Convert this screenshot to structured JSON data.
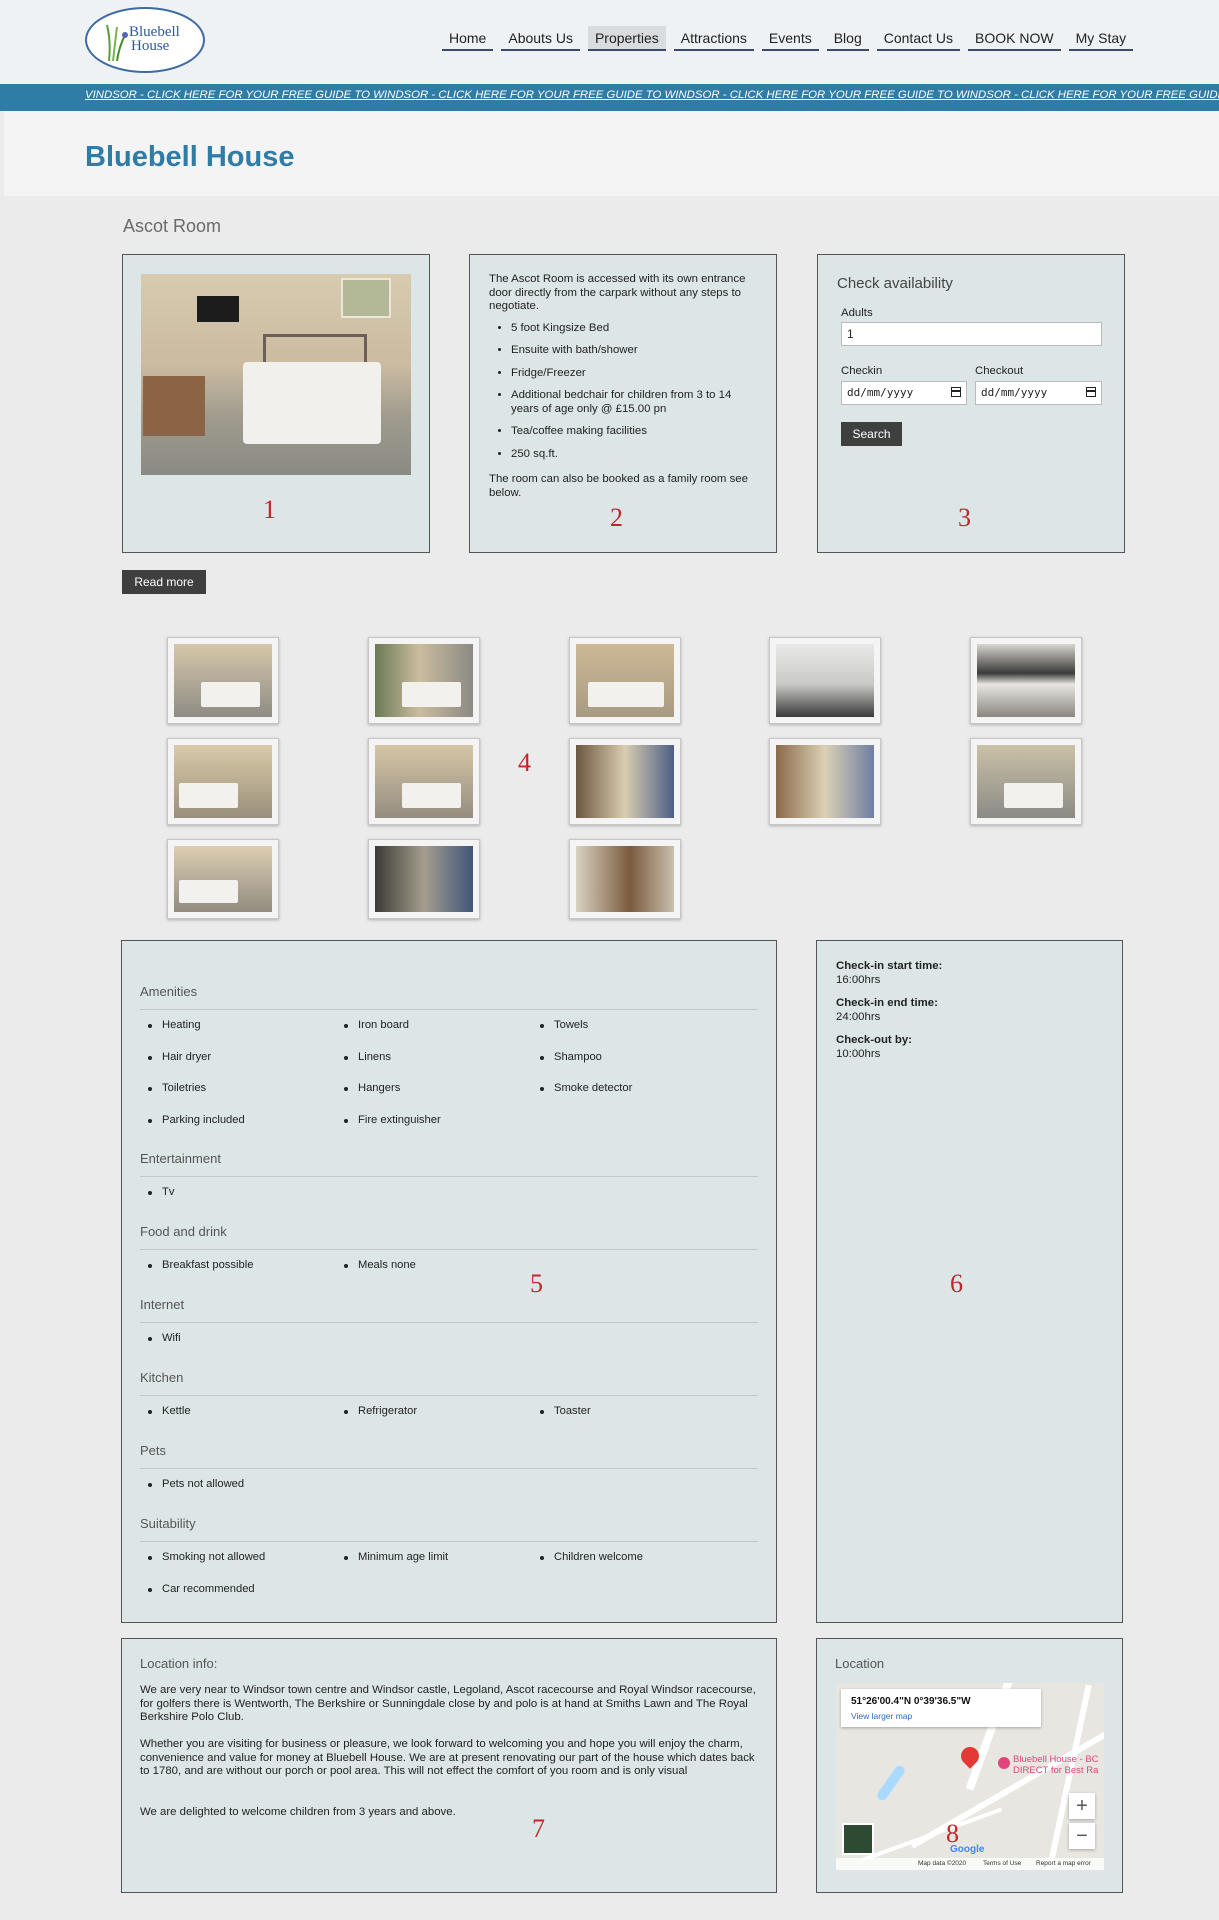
{
  "header": {
    "logo_text_line1": "Bluebell",
    "logo_text_line2": "House",
    "nav": [
      "Home",
      "Abouts Us",
      "Properties",
      "Attractions",
      "Events",
      "Blog",
      "Contact Us",
      "BOOK NOW",
      "My Stay"
    ],
    "active_nav": "Properties"
  },
  "ticker": {
    "text": "VINDSOR - CLICK HERE FOR YOUR FREE GUIDE TO WINDSOR - CLICK HERE FOR YOUR FREE GUIDE TO WINDSOR - CLICK HERE FOR YOUR FREE GUIDE TO WINDSOR - CLICK HERE FOR YOUR FREE GUIDE TO WINDSOR\""
  },
  "page": {
    "site_title": "Bluebell House",
    "room_title": "Ascot Room"
  },
  "photo_box": {
    "number": "1"
  },
  "description": {
    "intro": "The Ascot Room is accessed with its own entrance door directly from the carpark without any steps to negotiate.",
    "features": [
      "5 foot Kingsize Bed",
      "Ensuite with bath/shower",
      "Fridge/Freezer",
      "Additional bedchair for children from 3 to 14 years of age only @ £15.00 pn",
      "Tea/coffee making facilities",
      "250 sq.ft."
    ],
    "outro": "The room can also be booked as a family room see below.",
    "number": "2"
  },
  "availability": {
    "heading": "Check availability",
    "adults_label": "Adults",
    "adults_value": "1",
    "checkin_label": "Checkin",
    "checkout_label": "Checkout",
    "date_placeholder": "dd/mm/yyyy",
    "search_label": "Search",
    "number": "3"
  },
  "read_more_label": "Read more",
  "gallery": {
    "number": "4",
    "thumb_count": 13
  },
  "amenities": {
    "number": "5",
    "sections": [
      {
        "title": "Amenities",
        "items": [
          "Heating",
          "Iron board",
          "Towels",
          "Hair dryer",
          "Linens",
          "Shampoo",
          "Toiletries",
          "Hangers",
          "Smoke detector",
          "Parking included",
          "Fire extinguisher"
        ]
      },
      {
        "title": "Entertainment",
        "items": [
          "Tv"
        ]
      },
      {
        "title": "Food and drink",
        "items": [
          "Breakfast possible",
          "Meals none"
        ]
      },
      {
        "title": "Internet",
        "items": [
          "Wifi"
        ]
      },
      {
        "title": "Kitchen",
        "items": [
          "Kettle",
          "Refrigerator",
          "Toaster"
        ]
      },
      {
        "title": "Pets",
        "items": [
          "Pets not allowed"
        ]
      },
      {
        "title": "Suitability",
        "items": [
          "Smoking not allowed",
          "Minimum age limit",
          "Children welcome",
          "Car recommended"
        ]
      }
    ]
  },
  "checkin": {
    "number": "6",
    "start_label": "Check-in start time:",
    "start_value": "16:00hrs",
    "end_label": "Check-in end time:",
    "end_value": "24:00hrs",
    "out_label": "Check-out by:",
    "out_value": "10:00hrs"
  },
  "location_info": {
    "heading": "Location info:",
    "p1": "We are very near to Windsor town centre and Windsor castle, Legoland, Ascot racecourse and Royal Windsor racecourse, for golfers there is Wentworth, The Berkshire or Sunningdale close by and polo is at hand at Smiths Lawn and The Royal Berkshire Polo Club.",
    "p2": "Whether you are visiting for business or pleasure, we look forward to welcoming you and hope you will enjoy the charm, convenience and value for money at Bluebell House. We are at present renovating our part of the house which dates back to 1780, and are without our porch or pool area. This will not effect the comfort of you room and is only visual",
    "p3": "We are delighted to welcome children from 3 years and above.",
    "number": "7"
  },
  "location_map": {
    "heading": "Location",
    "coords": "51°26'00.4\"N 0°39'36.5\"W",
    "view_larger": "View larger map",
    "place_line1": "Bluebell House - BC",
    "place_line2": "DIRECT for Best Ra",
    "zoom_in": "+",
    "zoom_out": "−",
    "google": "Google",
    "map_data": "Map data ©2020",
    "terms": "Terms of Use",
    "report": "Report a map error",
    "number": "8"
  }
}
